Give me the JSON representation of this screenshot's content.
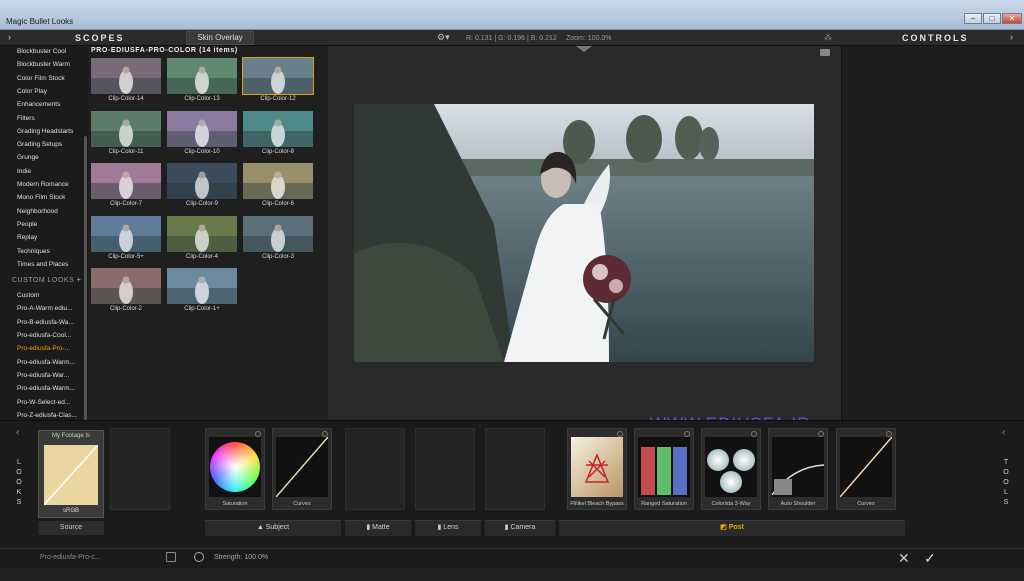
{
  "window": {
    "title": "Magic Bullet Looks",
    "buttons": [
      "–",
      "□",
      "✕"
    ]
  },
  "topbar": {
    "scopes": "SCOPES",
    "skin_overlay": "Skin Overlay",
    "readout": "R: 0.131 | G: 0.196 | B: 0.212",
    "zoom": "Zoom: 100.0%",
    "controls": "CONTROLS"
  },
  "sidebar": {
    "items": [
      "Blockbuster Cool",
      "Blockbuster Warm",
      "Color Film Stock",
      "Color Play",
      "Enhancements",
      "Filters",
      "Grading Headstarts",
      "Grading Setups",
      "Grunge",
      "Indie",
      "Modern Romance",
      "Mono Film Stock",
      "Neighborhood",
      "People",
      "Replay",
      "Techniques",
      "Times and Places"
    ],
    "custom_header": "CUSTOM LOOKS",
    "custom_items": [
      "Custom",
      "Pro-A-Warm ediu...",
      "Pro-B-ediusfa-Wa...",
      "Pro-ediusfa-Cool...",
      "Pro-ediusfa-Pro-...",
      "Pro-ediusfa-Warm...",
      "Pro-ediusfa-War...",
      "Pro-ediusfa-Warm...",
      "Pro-W-Select-ed...",
      "Pro-Z-ediusfa-Clas..."
    ]
  },
  "gallery": {
    "title": "PRO-EDIUSFA-PRO-COLOR (14 items)",
    "thumbs": [
      "Clip-Color-14",
      "Clip-Color-13",
      "Clip-Color-12",
      "Clip-Color-11",
      "Clip-Color-10",
      "Clip-Color-8",
      "Clip-Color-7",
      "Clip-Color-9",
      "Clip-Color-6",
      "Clip-Color-5+",
      "Clip-Color-4",
      "Clip-Color-3",
      "Clip-Color-2",
      "Clip-Color-1+"
    ],
    "tints": [
      "#7a6a78",
      "#5f8a70",
      "#6a7f8c",
      "#5c7c6a",
      "#8a7aa0",
      "#4f8a8a",
      "#a07a98",
      "#3c4c5c",
      "#9a8f6a",
      "#5f7c9a",
      "#6a7a4c",
      "#5a6f7a",
      "#8a6a6a",
      "#6a8aa0"
    ]
  },
  "looks": {
    "label": "LOOKS",
    "footage_title": "My Footage Is",
    "footage_value": "sRGB",
    "source": "Source"
  },
  "tools_label": "TOOLS",
  "tools_left": [
    {
      "label": "Saturation",
      "icon": "color-wheel-icon"
    },
    {
      "label": "Curves",
      "icon": "curve-icon"
    }
  ],
  "tools_right": [
    {
      "label": "Pillikel Bleach Bypass",
      "icon": "bleach-bypass-icon"
    },
    {
      "label": "Ranged Saturation",
      "icon": "ranged-saturation-icon"
    },
    {
      "label": "Colorista 3-Way",
      "icon": "three-way-icon"
    },
    {
      "label": "Auto Shoulder",
      "icon": "shoulder-curve-icon"
    },
    {
      "label": "Curves",
      "icon": "curve-icon"
    }
  ],
  "categories": {
    "subject": "Subject",
    "matte": "Matte",
    "lens": "Lens",
    "camera": "Camera",
    "post": "Post"
  },
  "status": {
    "look_name": "Pro-ediusfa-Pro-c...",
    "strength": "Strength: 100.0%"
  },
  "watermark": "WWW.EDIUSFA.IR",
  "colors": {
    "accent": "#f0a500",
    "watermark": "#5a4ee8"
  }
}
